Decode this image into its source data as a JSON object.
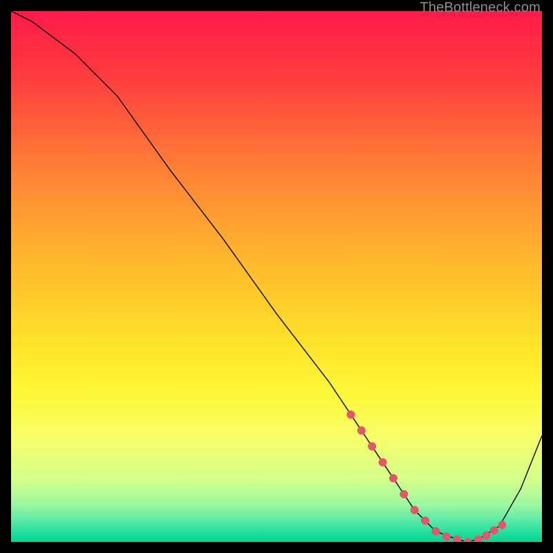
{
  "watermark": "TheBottleneck.com",
  "chart_data": {
    "type": "line",
    "title": "",
    "xlabel": "",
    "ylabel": "",
    "xlim": [
      0,
      100
    ],
    "ylim": [
      0,
      100
    ],
    "grid": false,
    "legend": false,
    "background_gradient": {
      "stops": [
        {
          "offset": 0.0,
          "color": "#ff1a48"
        },
        {
          "offset": 0.12,
          "color": "#ff3b3f"
        },
        {
          "offset": 0.28,
          "color": "#ff7a36"
        },
        {
          "offset": 0.45,
          "color": "#ffb22e"
        },
        {
          "offset": 0.62,
          "color": "#ffe12a"
        },
        {
          "offset": 0.72,
          "color": "#fff838"
        },
        {
          "offset": 0.8,
          "color": "#f7ff66"
        },
        {
          "offset": 0.88,
          "color": "#d6ff8a"
        },
        {
          "offset": 0.93,
          "color": "#9cf7a0"
        },
        {
          "offset": 0.96,
          "color": "#5ae9a8"
        },
        {
          "offset": 0.985,
          "color": "#1adf9c"
        },
        {
          "offset": 1.0,
          "color": "#00d68f"
        }
      ]
    },
    "series": [
      {
        "name": "bottleneck-curve",
        "color": "#000000",
        "width": 1.4,
        "x": [
          0,
          4,
          8,
          12,
          20,
          30,
          40,
          50,
          60,
          64,
          68,
          72,
          76,
          80,
          84,
          86,
          88,
          92,
          96,
          100
        ],
        "y": [
          100,
          98,
          95,
          92,
          84,
          70,
          57,
          43,
          30,
          24,
          18,
          12,
          6,
          2,
          0.5,
          0,
          0.5,
          3,
          10,
          20
        ]
      }
    ],
    "markers": {
      "name": "highlight-dots",
      "color": "#e4576a",
      "radius": 6,
      "x": [
        64,
        66,
        68,
        70,
        72,
        74,
        76,
        78,
        80,
        82,
        84,
        86,
        88,
        89.5,
        91,
        92.5
      ],
      "y": [
        24,
        21,
        18,
        15,
        12,
        9,
        6,
        4,
        2,
        1,
        0.5,
        0,
        0.5,
        1.2,
        2.2,
        3.2
      ]
    },
    "annotations": []
  }
}
